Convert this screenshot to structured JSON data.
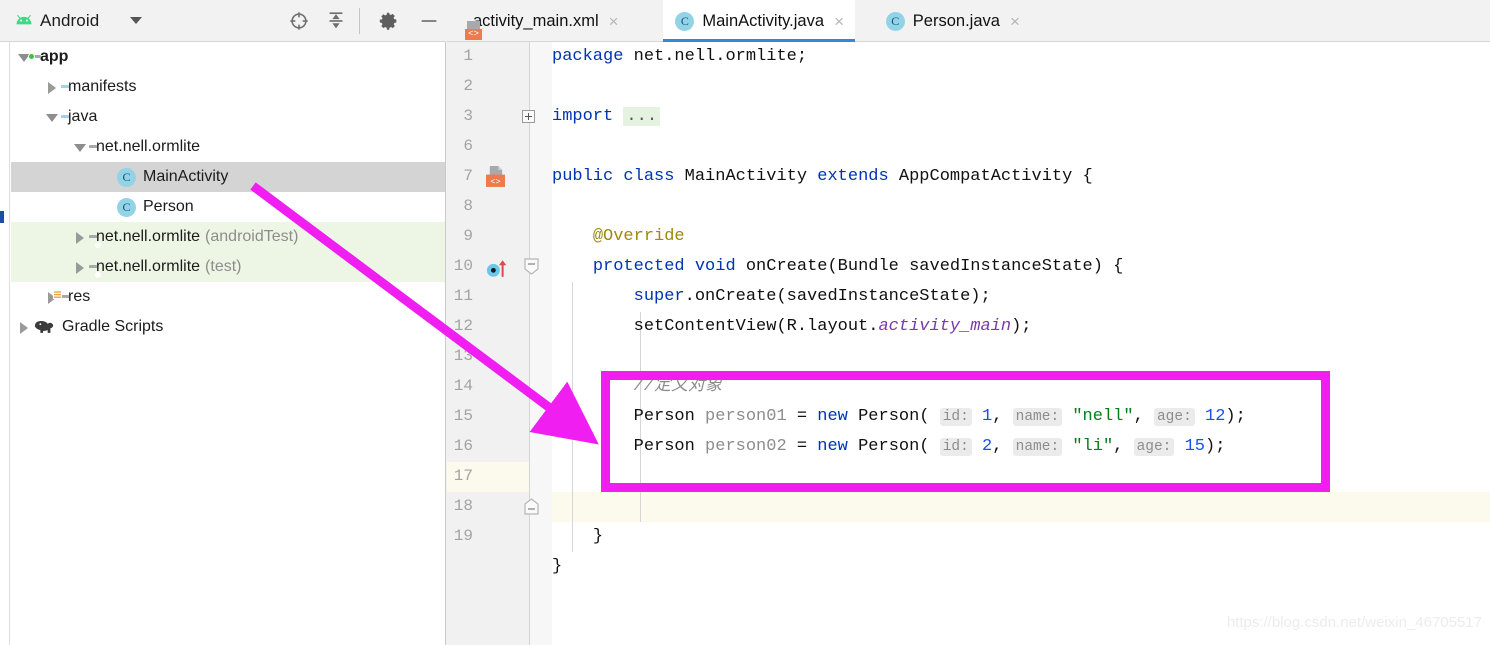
{
  "panel": {
    "title": "Android",
    "logo_icon": "android-robot-icon",
    "dropdown_icon": "chevron-down-icon",
    "toolbar": [
      {
        "name": "locate-in-tree-icon",
        "label": "target-crosshair"
      },
      {
        "name": "collapse-all-icon",
        "label": "collapse-all"
      },
      {
        "name": "settings-gear-icon",
        "label": "gear"
      },
      {
        "name": "hide-panel-icon",
        "label": "minimize"
      }
    ]
  },
  "tree": [
    {
      "label": "app",
      "suffix": "",
      "icon": "folder-module-icon",
      "indent": 0,
      "twisty": "expanded",
      "bold": true,
      "selected": false,
      "test": false
    },
    {
      "label": "manifests",
      "suffix": "",
      "icon": "folder-blue-icon",
      "indent": 1,
      "twisty": "collapsed",
      "bold": false,
      "selected": false,
      "test": false
    },
    {
      "label": "java",
      "suffix": "",
      "icon": "folder-blue-icon",
      "indent": 1,
      "twisty": "expanded",
      "bold": false,
      "selected": false,
      "test": false
    },
    {
      "label": "net.nell.ormlite",
      "suffix": "",
      "icon": "package-icon",
      "indent": 2,
      "twisty": "expanded",
      "bold": false,
      "selected": false,
      "test": false
    },
    {
      "label": "MainActivity",
      "suffix": "",
      "icon": "java-class-icon",
      "indent": 3,
      "twisty": "none",
      "bold": false,
      "selected": true,
      "test": false
    },
    {
      "label": "Person",
      "suffix": "",
      "icon": "java-class-icon",
      "indent": 3,
      "twisty": "none",
      "bold": false,
      "selected": false,
      "test": false
    },
    {
      "label": "net.nell.ormlite",
      "suffix": "(androidTest)",
      "icon": "package-icon",
      "indent": 2,
      "twisty": "collapsed",
      "bold": false,
      "selected": false,
      "test": true
    },
    {
      "label": "net.nell.ormlite",
      "suffix": "(test)",
      "icon": "package-icon",
      "indent": 2,
      "twisty": "collapsed",
      "bold": false,
      "selected": false,
      "test": true
    },
    {
      "label": "res",
      "suffix": "",
      "icon": "folder-res-icon",
      "indent": 1,
      "twisty": "collapsed",
      "bold": false,
      "selected": false,
      "test": false
    },
    {
      "label": "Gradle Scripts",
      "suffix": "",
      "icon": "gradle-elephant-icon",
      "indent": 0,
      "twisty": "collapsed",
      "bold": false,
      "selected": false,
      "test": false
    }
  ],
  "tabs": [
    {
      "label": "activity_main.xml",
      "icon": "xml-layout-icon",
      "active": false,
      "close": "×"
    },
    {
      "label": "MainActivity.java",
      "icon": "java-class-icon",
      "active": true,
      "close": "×"
    },
    {
      "label": "Person.java",
      "icon": "java-class-icon",
      "active": false,
      "close": "×"
    }
  ],
  "editor": {
    "active_file": "MainActivity.java",
    "caret_line": 17,
    "accent_color": "#3b86d0",
    "line_numbers": [
      1,
      2,
      3,
      6,
      7,
      8,
      9,
      10,
      11,
      12,
      13,
      14,
      15,
      16,
      17,
      18,
      19
    ],
    "lines": [
      {
        "num": 1,
        "text": "package net.nell.ormlite;"
      },
      {
        "num": 2,
        "text": ""
      },
      {
        "num": 3,
        "text": "import ..."
      },
      {
        "num": 6,
        "text": ""
      },
      {
        "num": 7,
        "text": "public class MainActivity extends AppCompatActivity {"
      },
      {
        "num": 8,
        "text": ""
      },
      {
        "num": 9,
        "text": "    @Override"
      },
      {
        "num": 10,
        "text": "    protected void onCreate(Bundle savedInstanceState) {"
      },
      {
        "num": 11,
        "text": "        super.onCreate(savedInstanceState);"
      },
      {
        "num": 12,
        "text": "        setContentView(R.layout.activity_main);"
      },
      {
        "num": 13,
        "text": ""
      },
      {
        "num": 14,
        "text": "        //定义对象"
      },
      {
        "num": 15,
        "text": "        Person person01 = new Person( id: 1, name: \"nell\", age: 12);"
      },
      {
        "num": 16,
        "text": "        Person person02 = new Person( id: 2, name: \"li\", age: 15);"
      },
      {
        "num": 17,
        "text": ""
      },
      {
        "num": 18,
        "text": "    }"
      },
      {
        "num": 19,
        "text": "}"
      }
    ],
    "tokens": {
      "kw_package": "package",
      "pkg_name": " net.nell.ormlite;",
      "kw_import": "import",
      "import_fold": "...",
      "kw_public": "public",
      "kw_class": "class",
      "cls_main": "MainActivity",
      "kw_extends": "extends",
      "cls_appcompat": "AppCompatActivity {",
      "annotation_override": "@Override",
      "kw_protected": "protected",
      "kw_void": "void",
      "m_oncreate": "onCreate(Bundle savedInstanceState) {",
      "kw_super": "super",
      "super_call": ".onCreate(savedInstanceState);",
      "setcontentview": "setContentView(R.layout.",
      "field_activity_main": "activity_main",
      "setcontentview_end": ");",
      "comment_cn": "//定义对象",
      "type_person": "Person",
      "var_person01": "person01",
      "var_person02": "person02",
      "eq": "=",
      "kw_new": "new",
      "ctor_person": "Person(",
      "hint_id": "id:",
      "hint_name": "name:",
      "hint_age": "age:",
      "id1": "1",
      "id2": "2",
      "name1": "\"nell\"",
      "name2": "\"li\"",
      "age1": "12",
      "age2": "15",
      "comma": ",",
      "close_paren": ");",
      "brace_close": "}"
    },
    "gutter_icons": [
      {
        "name": "layout-file-marker-icon",
        "line": 7
      },
      {
        "name": "override-method-marker-icon",
        "line": 10
      }
    ]
  },
  "annotations": {
    "highlight_box_color": "#f01ef0",
    "arrow_color": "#f01ef0",
    "arrow_from": "MainActivity tree node",
    "arrow_to": "Person constructor lines"
  },
  "watermark": "https://blog.csdn.net/weixin_46705517"
}
